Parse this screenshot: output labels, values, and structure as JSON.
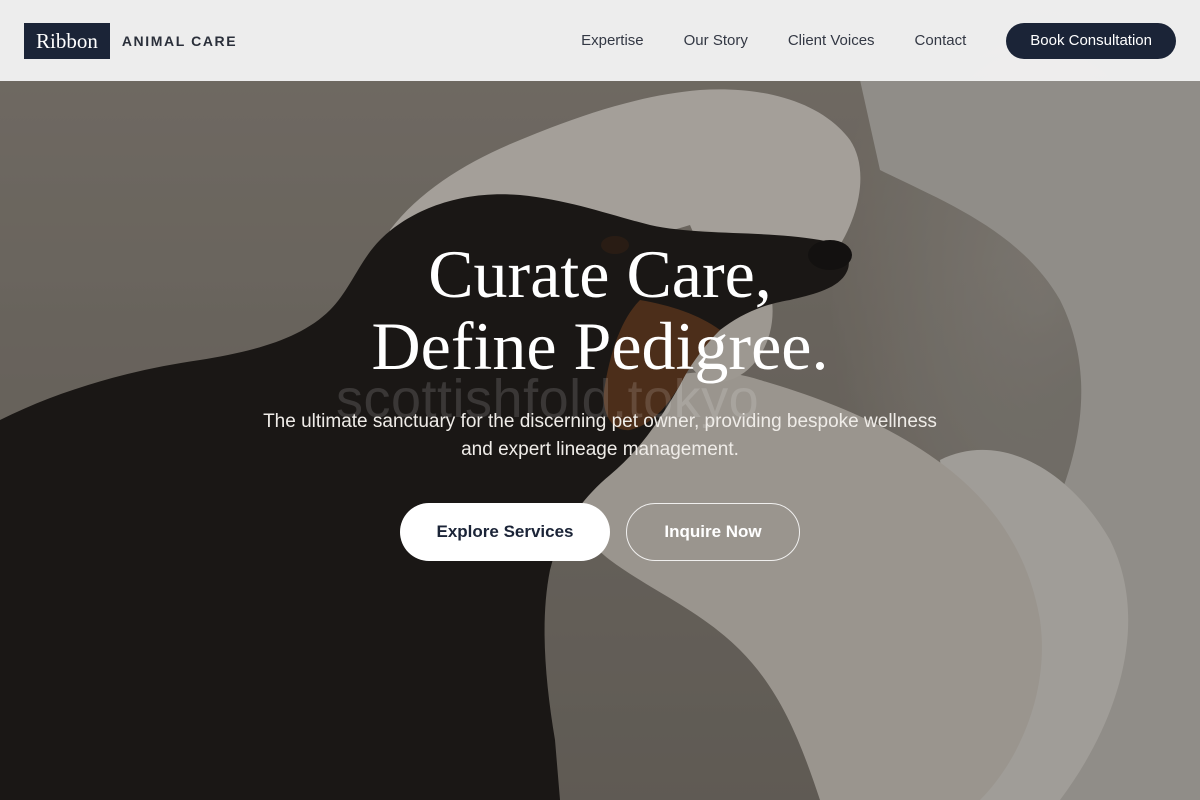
{
  "brand": {
    "logo_box": "Ribbon",
    "logo_text": "ANIMAL CARE",
    "colors": {
      "navy": "#1b2437",
      "header_bg": "#f2f2f2",
      "white": "#ffffff"
    }
  },
  "nav": {
    "links": [
      {
        "label": "Expertise"
      },
      {
        "label": "Our Story"
      },
      {
        "label": "Client Voices"
      },
      {
        "label": "Contact"
      }
    ],
    "cta_label": "Book Consultation"
  },
  "hero": {
    "title_line1": "Curate Care,",
    "title_line2": "Define Pedigree.",
    "subtitle": "The ultimate sanctuary for the discerning pet owner, providing bespoke wellness and expert lineage management.",
    "primary_button": "Explore Services",
    "secondary_button": "Inquire Now",
    "watermark": "scottishfold.tokyo",
    "image": "veterinarian gloved hands examining dachshund"
  }
}
